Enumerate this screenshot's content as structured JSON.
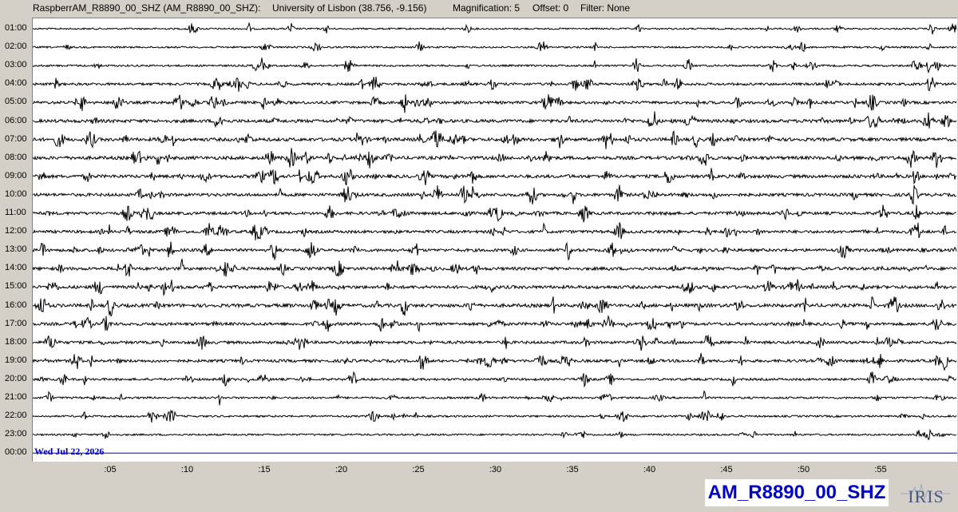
{
  "header": {
    "station": "RaspberrAM_R8890_00_SHZ (AM_R8890_00_SHZ):",
    "location": "University of Lisbon (38.756, -9.156)",
    "magnification": "Magnification: 5",
    "offset": "Offset: 0",
    "filter": "Filter: None"
  },
  "hour_labels": [
    "01:00",
    "02:00",
    "03:00",
    "04:00",
    "05:00",
    "06:00",
    "07:00",
    "08:00",
    "09:00",
    "10:00",
    "11:00",
    "12:00",
    "13:00",
    "14:00",
    "15:00",
    "16:00",
    "17:00",
    "18:00",
    "19:00",
    "20:00",
    "21:00",
    "22:00",
    "23:00",
    "00:00"
  ],
  "date_label": "Wed Jul 22, 2026",
  "minute_ticks": [
    ":05",
    ":10",
    ":15",
    ":20",
    ":25",
    ":30",
    ":35",
    ":40",
    ":45",
    ":50",
    ":55"
  ],
  "channel_label": "AM_R8890_00_SHZ",
  "logo_text": "IRIS",
  "colors": {
    "trace": "#000000",
    "current_line": "#0000cc",
    "label_blue": "#0000cc",
    "background": "#d4d0c8",
    "plot_bg": "#ffffff"
  },
  "trace_activity": [
    0.25,
    0.3,
    0.35,
    0.6,
    0.7,
    0.85,
    0.9,
    0.9,
    0.85,
    0.8,
    0.75,
    0.75,
    0.75,
    0.8,
    0.85,
    0.9,
    0.75,
    0.7,
    0.7,
    0.5,
    0.4,
    0.35,
    0.3,
    0.0
  ]
}
